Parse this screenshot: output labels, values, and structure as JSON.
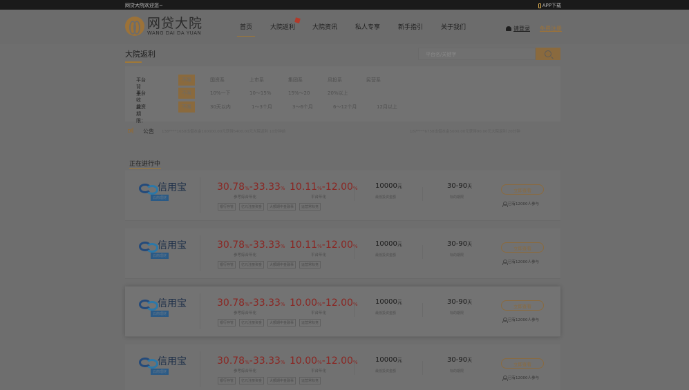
{
  "topbar": {
    "welcome": "网贷大院欢迎您~",
    "app_download": "APP下载"
  },
  "logo": {
    "cn": "网贷大院",
    "en": "WANG DAI DA YUAN"
  },
  "nav": [
    {
      "label": "首页",
      "active": true
    },
    {
      "label": "大院返利",
      "active": false,
      "badge": true
    },
    {
      "label": "大院资讯",
      "active": false
    },
    {
      "label": "私人专享",
      "active": false
    },
    {
      "label": "新手指引",
      "active": false
    },
    {
      "label": "关于我们",
      "active": false
    }
  ],
  "auth": {
    "login": "请登录",
    "register": "免费注册"
  },
  "page": {
    "title": "大院返利",
    "search_placeholder": "平台名/关键字"
  },
  "filters": [
    {
      "label": "平台背景：",
      "options": [
        "不限",
        "国资系",
        "上市系",
        "集团系",
        "风投系",
        "民营系"
      ]
    },
    {
      "label": "平台收益：",
      "options": [
        "不限",
        "10%一下",
        "10～15%",
        "15%～20",
        "20%以上"
      ]
    },
    {
      "label": "投资期限：",
      "options": [
        "不限",
        "30天以内",
        "1～3个月",
        "3～6个月",
        "6～12个月",
        "12月以上"
      ]
    }
  ],
  "notice": {
    "label": "公告",
    "messages": [
      "138****1658出借本金100000.00元获得5400.00元大院返利 10分钟前",
      "187****6758出借本金5000.00元获得90.00元大院返利 20分钟"
    ]
  },
  "section_title": "正在进行中",
  "products": [
    {
      "platform": "信用宝",
      "tag": "云南理财",
      "ref_rate_low": "30.78",
      "ref_rate_high": "33.33",
      "ref_label": "参考综合年化",
      "plat_rate_low": "10.11",
      "plat_rate_high": "12.00",
      "plat_label": "平台年化",
      "amount": "10000",
      "amount_unit": "元",
      "amount_label": "最低投资金额",
      "term": "30-90",
      "term_unit": "天",
      "term_label": "标的期限",
      "button": "立即查看",
      "participants": "已有12000人参与",
      "badges": [
        "银行存管",
        "亿元注册资金",
        "大额期中金融事",
        "运营常标竞"
      ],
      "highlight": false
    },
    {
      "platform": "信用宝",
      "tag": "云南理财",
      "ref_rate_low": "30.78",
      "ref_rate_high": "33.33",
      "ref_label": "参考综合年化",
      "plat_rate_low": "10.11",
      "plat_rate_high": "12.00",
      "plat_label": "平台年化",
      "amount": "10000",
      "amount_unit": "元",
      "amount_label": "最低投资金额",
      "term": "30-90",
      "term_unit": "天",
      "term_label": "标的期限",
      "button": "立即查看",
      "participants": "已有12000人参与",
      "badges": [
        "银行存管",
        "亿元注册资金",
        "大额期中金融事",
        "运营常标竞"
      ],
      "highlight": false
    },
    {
      "platform": "信用宝",
      "tag": "云南理财",
      "ref_rate_low": "30.78",
      "ref_rate_high": "33.33",
      "ref_label": "参考综合年化",
      "plat_rate_low": "10.00",
      "plat_rate_high": "12.00",
      "plat_label": "平台年化",
      "amount": "10000",
      "amount_unit": "元",
      "amount_label": "最低投资金额",
      "term": "30-90",
      "term_unit": "天",
      "term_label": "标的期限",
      "button": "立即查看",
      "participants": "已有12000人参与",
      "badges": [
        "银行存管",
        "亿元注册资金",
        "大额期中金融事",
        "运营常标竞"
      ],
      "highlight": true
    },
    {
      "platform": "信用宝",
      "tag": "云南理财",
      "ref_rate_low": "30.78",
      "ref_rate_high": "33.33",
      "ref_label": "参考综合年化",
      "plat_rate_low": "10.00",
      "plat_rate_high": "12.00",
      "plat_label": "平台年化",
      "amount": "10000",
      "amount_unit": "元",
      "amount_label": "最低投资金额",
      "term": "30-90",
      "term_unit": "天",
      "term_label": "标的期限",
      "button": "立即查看",
      "participants": "已有12000人参与",
      "badges": [
        "银行存管",
        "亿元注册资金",
        "大额期中金融事",
        "运营常标竞"
      ],
      "highlight": false
    }
  ],
  "colors": {
    "accent": "#a07836",
    "rate_red": "#8a2622",
    "overlay_gray": "#6e6e6e"
  }
}
